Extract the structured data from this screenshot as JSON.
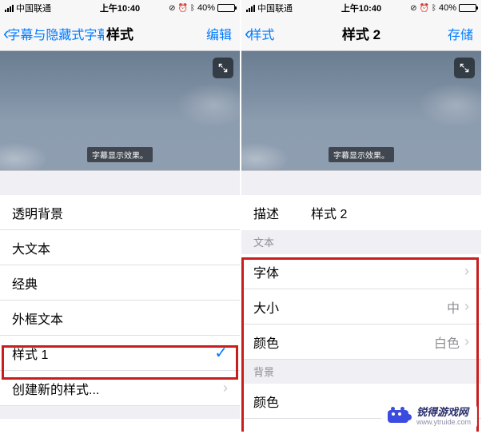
{
  "status": {
    "carrier": "中国联通",
    "time": "上午10:40",
    "battery_pct": "40%"
  },
  "left": {
    "back_label": "字幕与隐藏式字幕",
    "title": "样式",
    "right_action": "编辑",
    "caption_sample": "字幕显示效果。",
    "rows": [
      {
        "label": "透明背景"
      },
      {
        "label": "大文本"
      },
      {
        "label": "经典"
      },
      {
        "label": "外框文本"
      },
      {
        "label": "样式 1",
        "checked": true
      },
      {
        "label": "创建新的样式...",
        "chevron": true
      }
    ]
  },
  "right": {
    "back_label": "样式",
    "title": "样式 2",
    "right_action": "存储",
    "caption_sample": "字幕显示效果。",
    "desc_label": "描述",
    "desc_value": "样式 2",
    "section_text": "文本",
    "text_rows": [
      {
        "label": "字体",
        "value": "",
        "chevron": true
      },
      {
        "label": "大小",
        "value": "中",
        "chevron": true
      },
      {
        "label": "颜色",
        "value": "白色",
        "chevron": true
      }
    ],
    "section_bg": "背景",
    "bg_rows": [
      {
        "label": "颜色"
      }
    ]
  },
  "watermark": {
    "brand": "锐得游戏网",
    "url": "www.ytruide.com"
  }
}
